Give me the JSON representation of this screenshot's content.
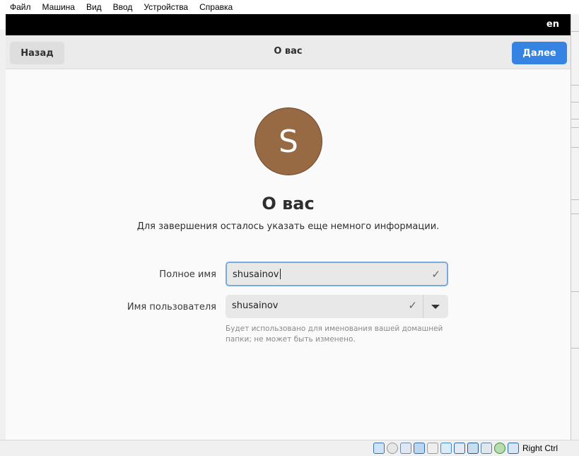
{
  "vbox": {
    "menu": [
      "Файл",
      "Машина",
      "Вид",
      "Ввод",
      "Устройства",
      "Справка"
    ],
    "host_key": "Right Ctrl"
  },
  "gnome": {
    "language": "en"
  },
  "header": {
    "back_label": "Назад",
    "title": "О вас",
    "next_label": "Далее"
  },
  "page": {
    "avatar_letter": "S",
    "title": "О вас",
    "subtitle": "Для завершения осталось указать еще немного информации."
  },
  "form": {
    "fullname_label": "Полное имя",
    "fullname_value": "shusainov",
    "username_label": "Имя пользователя",
    "username_value": "shusainov",
    "hint": "Будет использовано для именования вашей домашней папки; не может быть изменено."
  },
  "colors": {
    "accent": "#3584e4",
    "avatar": "#986a44"
  }
}
